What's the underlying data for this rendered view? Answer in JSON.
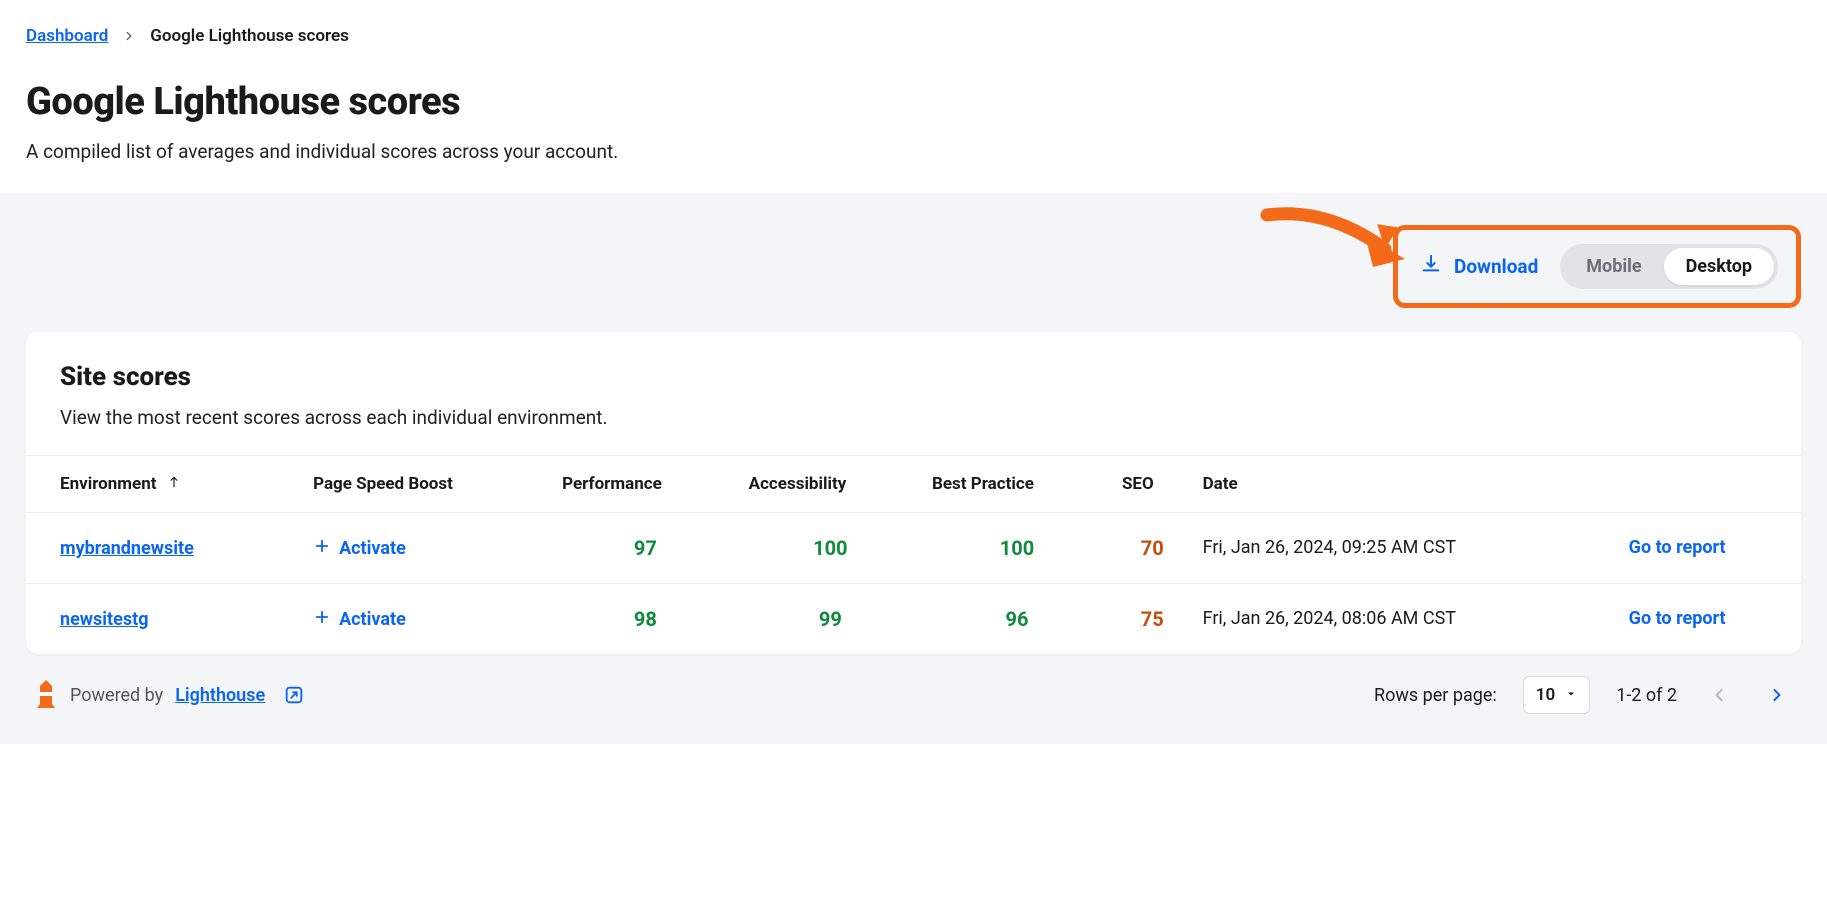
{
  "breadcrumb": {
    "root": "Dashboard",
    "current": "Google Lighthouse scores"
  },
  "page": {
    "title": "Google Lighthouse scores",
    "subtitle": "A compiled list of averages and individual scores across your account."
  },
  "toolbar": {
    "download_label": "Download",
    "view_mobile": "Mobile",
    "view_desktop": "Desktop",
    "active_view": "Desktop"
  },
  "card": {
    "title": "Site scores",
    "subtitle": "View the most recent scores across each individual environment."
  },
  "table": {
    "columns": {
      "environment": "Environment",
      "page_speed_boost": "Page Speed Boost",
      "performance": "Performance",
      "accessibility": "Accessibility",
      "best_practice": "Best Practice",
      "seo": "SEO",
      "date": "Date"
    },
    "activate_label": "Activate",
    "report_label": "Go to report",
    "rows": [
      {
        "env": "mybrandnewsite",
        "performance": "97",
        "accessibility": "100",
        "best_practice": "100",
        "seo": "70",
        "date": "Fri, Jan 26, 2024, 09:25 AM CST"
      },
      {
        "env": "newsitestg",
        "performance": "98",
        "accessibility": "99",
        "best_practice": "96",
        "seo": "75",
        "date": "Fri, Jan 26, 2024, 08:06 AM CST"
      }
    ]
  },
  "footer": {
    "powered_by": "Powered by",
    "lighthouse": "Lighthouse",
    "rows_per_page_label": "Rows per page:",
    "rows_per_page_value": "10",
    "range": "1-2 of 2"
  }
}
